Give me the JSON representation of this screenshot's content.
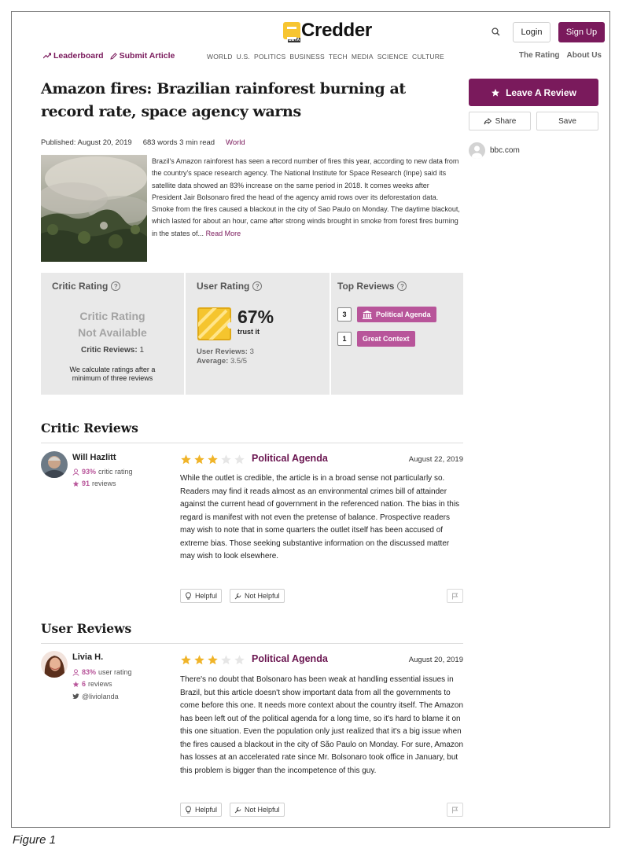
{
  "header": {
    "logo_badge": "BETA",
    "logo_text": "Credder",
    "login_label": "Login",
    "signup_label": "Sign Up"
  },
  "nav": {
    "leaderboard": "Leaderboard",
    "submit": "Submit Article",
    "sections": [
      "WORLD",
      "U.S.",
      "POLITICS",
      "BUSINESS",
      "TECH",
      "MEDIA",
      "SCIENCE",
      "CULTURE"
    ],
    "the_rating": "The Rating",
    "about_us": "About Us"
  },
  "article": {
    "title": "Amazon fires: Brazilian rainforest burning at record rate, space agency warns",
    "published": "Published: August 20, 2019",
    "words": "683 words 3 min read",
    "category": "World",
    "excerpt": "Brazil's Amazon rainforest has seen a record number of fires this year, according to new data from the country's space research agency. The National Institute for Space Research (Inpe) said its satellite data showed an 83% increase on the same period in 2018. It comes weeks after President Jair Bolsonaro fired the head of the agency amid rows over its deforestation data. Smoke from the fires caused a blackout in the city of Sao Paulo on Monday. The daytime blackout, which lasted for about an hour, came after strong winds brought in smoke from forest fires burning in the states of...",
    "read_more": "Read More"
  },
  "sidebar": {
    "leave_review": "Leave A Review",
    "share": "Share",
    "save": "Save",
    "source": "bbc.com"
  },
  "ratings": {
    "critic": {
      "heading": "Critic Rating",
      "na_line1": "Critic Rating",
      "na_line2": "Not Available",
      "count_label": "Critic Reviews:",
      "count_value": "1",
      "note_line1": "We calculate ratings after a",
      "note_line2": "minimum of three reviews"
    },
    "user": {
      "heading": "User Rating",
      "percent": "67%",
      "trust": "trust it",
      "reviews_label": "User Reviews:",
      "reviews_value": "3",
      "average_label": "Average:",
      "average_value": "3.5/5"
    },
    "top": {
      "heading": "Top Reviews",
      "items": [
        {
          "count": "3",
          "label": "Political Agenda"
        },
        {
          "count": "1",
          "label": "Great Context"
        }
      ]
    }
  },
  "critic_reviews": {
    "heading": "Critic Reviews",
    "items": [
      {
        "name": "Will Hazlitt",
        "rating_pct": "93%",
        "rating_label": "critic rating",
        "review_count": "91",
        "review_count_label": "reviews",
        "stars": 3,
        "tag": "Political Agenda",
        "date": "August 22, 2019",
        "body": "While the outlet is credible, the article is in a broad sense not particularly so. Readers may find it reads almost as an environmental crimes bill of attainder against the current head of government in the referenced nation. The bias in this regard is manifest with not even the pretense of balance. Prospective readers may wish to note that in some quarters the outlet itself has been accused of extreme bias. Those seeking substantive information on the discussed matter may wish to look elsewhere.",
        "helpful": "Helpful",
        "not_helpful": "Not Helpful"
      }
    ]
  },
  "user_reviews": {
    "heading": "User Reviews",
    "items": [
      {
        "name": "Livia H.",
        "rating_pct": "83%",
        "rating_label": "user rating",
        "review_count": "6",
        "review_count_label": "reviews",
        "handle": "@liviolanda",
        "stars": 3,
        "tag": "Political Agenda",
        "date": "August 20, 2019",
        "body": "There's no doubt that Bolsonaro has been weak at handling essential issues in Brazil, but this article doesn't show important data from all the governments to come before this one. It needs more context about the country itself. The Amazon has been left out of the political agenda for a long time, so it's hard to blame it on this one situation. Even the population only just realized that it's a big issue when the fires caused a blackout in the city of São Paulo on Monday. For sure, Amazon has losses at an accelerated rate since Mr. Bolsonaro took office in January, but this problem is bigger than the incompetence of this guy.",
        "helpful": "Helpful",
        "not_helpful": "Not Helpful"
      }
    ]
  },
  "figure_caption": "Figure 1",
  "colors": {
    "brand": "#7a1a5c",
    "tag": "#b8559a",
    "star": "#f0b429",
    "logo": "#f7c531"
  }
}
